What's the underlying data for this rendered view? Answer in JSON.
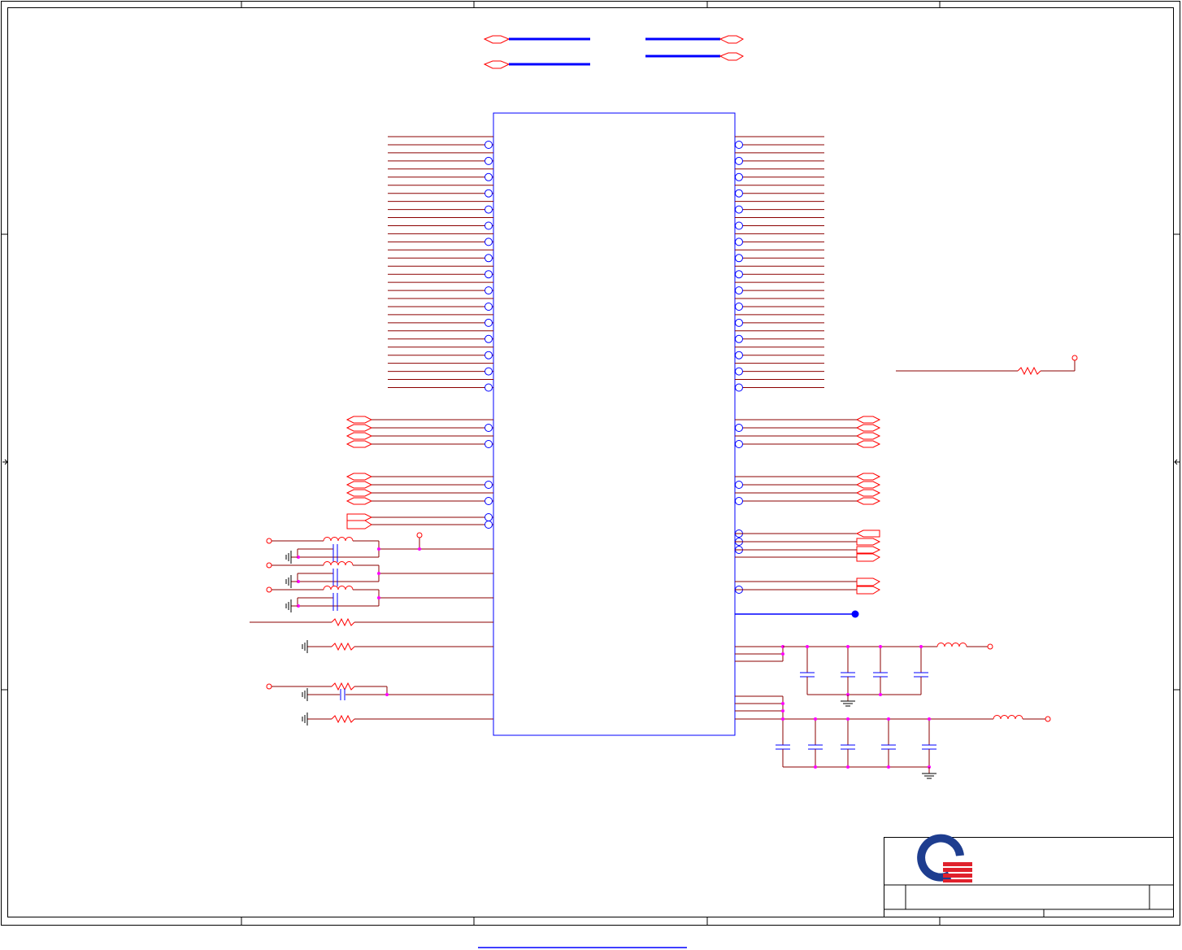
{
  "sheet": {
    "title_block": {
      "logo": "company-logo",
      "title": "",
      "size": "",
      "document_number": "",
      "rev": "",
      "date": "",
      "sheet": ""
    },
    "colors": {
      "frame": "#000000",
      "component": "#0000ff",
      "wire": "#8b0000",
      "net_port": "#ff0000",
      "junction": "#ff00ff",
      "logo_red": "#e0212c",
      "logo_blue": "#1e3d8f"
    }
  },
  "diagram": {
    "ic": {
      "pin_names": [],
      "part_label": ""
    },
    "left_bus_pins": 16,
    "right_bus_pins": 16,
    "components": [
      "ferrite-bead",
      "resistor",
      "capacitor",
      "inductor",
      "ground",
      "power-port",
      "net-port"
    ]
  }
}
